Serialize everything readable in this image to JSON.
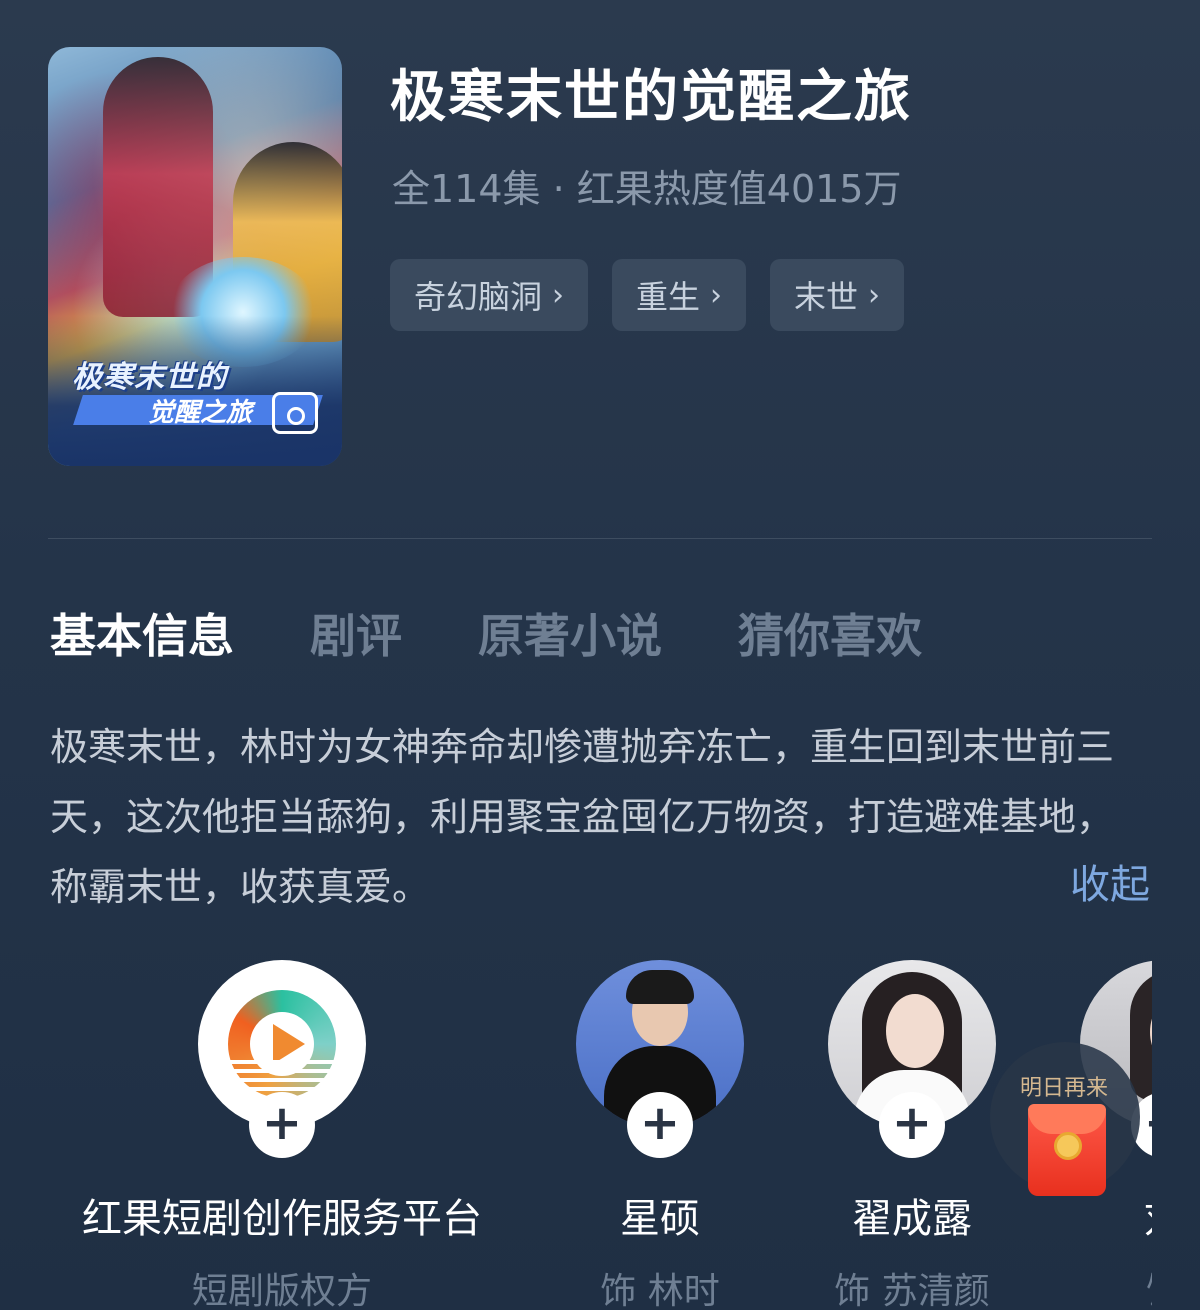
{
  "drama": {
    "title": "极寒末世的觉醒之旅",
    "meta": "全114集 · 红果热度值4015万",
    "poster": {
      "title_line1": "极寒末世的",
      "title_line2": "觉醒之旅"
    },
    "tags": [
      {
        "label": "奇幻脑洞",
        "icon": "chevron-right-icon"
      },
      {
        "label": "重生",
        "icon": "chevron-right-icon"
      },
      {
        "label": "末世",
        "icon": "chevron-right-icon"
      }
    ]
  },
  "tabs": [
    {
      "label": "基本信息",
      "active": true
    },
    {
      "label": "剧评",
      "active": false
    },
    {
      "label": "原著小说",
      "active": false
    },
    {
      "label": "猜你喜欢",
      "active": false
    }
  ],
  "description": {
    "text": "极寒末世，林时为女神奔命却惨遭抛弃冻亡，重生回到末世前三天，这次他拒当舔狗，利用聚宝盆囤亿万物资，打造避难基地，称霸末世，收获真爱。",
    "collapse_label": "收起"
  },
  "people": [
    {
      "name": "红果短剧创作服务平台",
      "role": "短剧版权方",
      "follow": "+"
    },
    {
      "name": "星硕",
      "role": "饰 林时",
      "follow": "+"
    },
    {
      "name": "翟成露",
      "role": "饰 苏清颜",
      "follow": "+"
    },
    {
      "name": "刘",
      "role": "饰",
      "follow": "+"
    }
  ],
  "floating_reward": {
    "label": "明日再来",
    "icon": "red-envelope-icon"
  },
  "colors": {
    "background": "#243449",
    "accent_link": "#7ea8e0",
    "tag_bg": "#3a4a5e"
  }
}
